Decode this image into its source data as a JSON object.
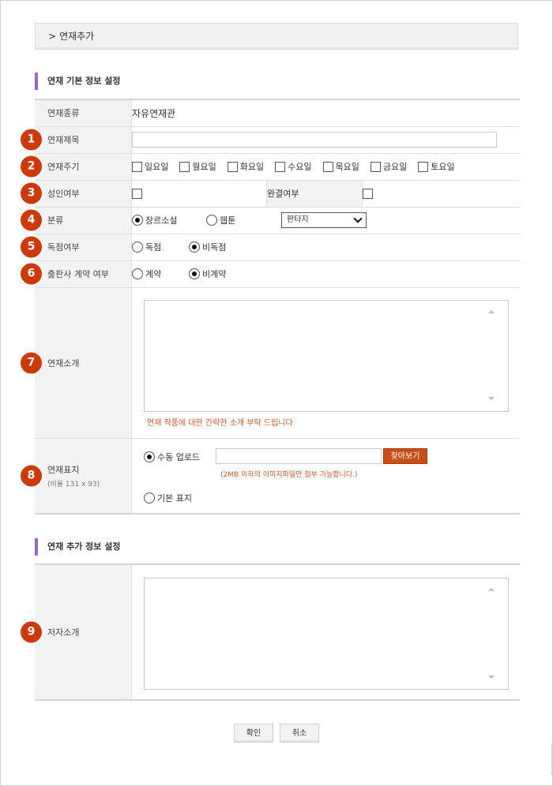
{
  "breadcrumb": {
    "chevron": ">",
    "label": "연재추가"
  },
  "section1": {
    "title": "연재 기본 정보 설정"
  },
  "section2": {
    "title": "연재 추가 정보 설정"
  },
  "accent_color": "#9966cc",
  "badge_color": "#cc3a0b",
  "rows": {
    "type": {
      "label": "연재종류",
      "value": "자유연재관"
    },
    "title": {
      "badge": "1",
      "label": "연재제목",
      "value": ""
    },
    "cycle": {
      "badge": "2",
      "label": "연재주기",
      "days": [
        "일요일",
        "월요일",
        "화요일",
        "수요일",
        "목요일",
        "금요일",
        "토요일"
      ]
    },
    "adult": {
      "badge": "3",
      "label": "성인여부",
      "complete_label": "완결여부"
    },
    "category": {
      "badge": "4",
      "label": "분류",
      "opt1": "장르소설",
      "opt2": "웹툰",
      "select_value": "판타지"
    },
    "exclusive": {
      "badge": "5",
      "label": "독점여부",
      "opt1": "독점",
      "opt2": "비독점"
    },
    "publisher": {
      "badge": "6",
      "label": "출판사 계약 여부",
      "opt1": "계약",
      "opt2": "비계약"
    },
    "intro": {
      "badge": "7",
      "label": "연재소개",
      "value": "",
      "note": "연재 작품에 대한 간략한 소개 부탁 드립니다"
    },
    "cover": {
      "badge": "8",
      "label": "연재표지",
      "sublabel": "(비율 131 x 93)",
      "manual": "수동 업로드",
      "find_button": "찾아보기",
      "note": "(2MB 이하의 이미지파일만 첨부 가능합니다.)",
      "default": "기본 표지"
    },
    "author": {
      "badge": "9",
      "label": "저자소개",
      "value": ""
    }
  },
  "buttons": {
    "confirm": "확인",
    "cancel": "취소"
  }
}
